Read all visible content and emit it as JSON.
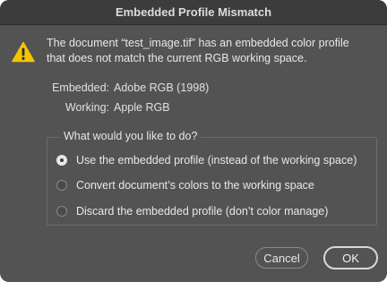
{
  "dialog": {
    "title": "Embedded Profile Mismatch",
    "message_line1": "The document “test_image.tif” has an embedded color profile",
    "message_line2": "that does not match the current RGB working space.",
    "icon": "warning-triangle-icon",
    "embedded_label": "Embedded:",
    "embedded_value": "Adobe RGB (1998)",
    "working_label": "Working:",
    "working_value": "Apple RGB"
  },
  "options_group": {
    "legend": "What would you like to do?",
    "options": [
      {
        "label": "Use the embedded profile (instead of the working space)",
        "selected": true
      },
      {
        "label": "Convert document’s colors to the working space",
        "selected": false
      },
      {
        "label": "Discard the embedded profile (don’t color manage)",
        "selected": false
      }
    ]
  },
  "buttons": {
    "cancel_label": "Cancel",
    "ok_label": "OK"
  },
  "colors": {
    "dialog_bg": "#535353",
    "titlebar_bg": "#3c3c3c",
    "warning_yellow": "#f5c400"
  }
}
